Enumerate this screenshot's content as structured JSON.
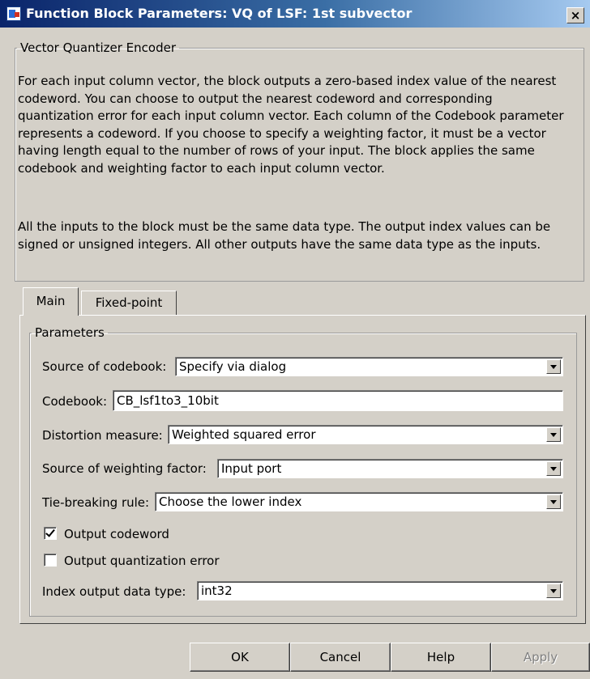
{
  "window": {
    "title": "Function Block Parameters: VQ of LSF: 1st subvector",
    "close_label": "×"
  },
  "description": {
    "group_title": "Vector Quantizer Encoder",
    "para1": "For each input column vector, the block outputs a zero-based index value of the nearest codeword. You can choose to output the nearest codeword and corresponding quantization error for each input column vector. Each column of the Codebook parameter represents a codeword. If you choose to specify a weighting factor, it must be a vector having length equal to the number of rows of your input. The block applies the same codebook and weighting factor to each input column vector.",
    "para2": "All the inputs to the block must be the same data type. The output index values can be signed or unsigned integers. All other outputs have the same data type as the inputs."
  },
  "tabs": [
    {
      "label": "Main",
      "selected": true
    },
    {
      "label": "Fixed-point",
      "selected": false
    }
  ],
  "params": {
    "group_title": "Parameters",
    "source_codebook": {
      "label": "Source of codebook:",
      "value": "Specify via dialog"
    },
    "codebook": {
      "label": "Codebook:",
      "value": "CB_lsf1to3_10bit"
    },
    "distortion": {
      "label": "Distortion measure:",
      "value": "Weighted squared error"
    },
    "weighting_source": {
      "label": "Source of weighting factor:",
      "value": "Input port"
    },
    "tie_breaking": {
      "label": "Tie-breaking rule:",
      "value": "Choose the lower index"
    },
    "output_codeword": {
      "label": "Output codeword",
      "checked": true
    },
    "output_qerror": {
      "label": "Output quantization error",
      "checked": false
    },
    "index_dtype": {
      "label": "Index output data type:",
      "value": "int32"
    }
  },
  "buttons": {
    "ok": "OK",
    "cancel": "Cancel",
    "help": "Help",
    "apply": "Apply"
  }
}
